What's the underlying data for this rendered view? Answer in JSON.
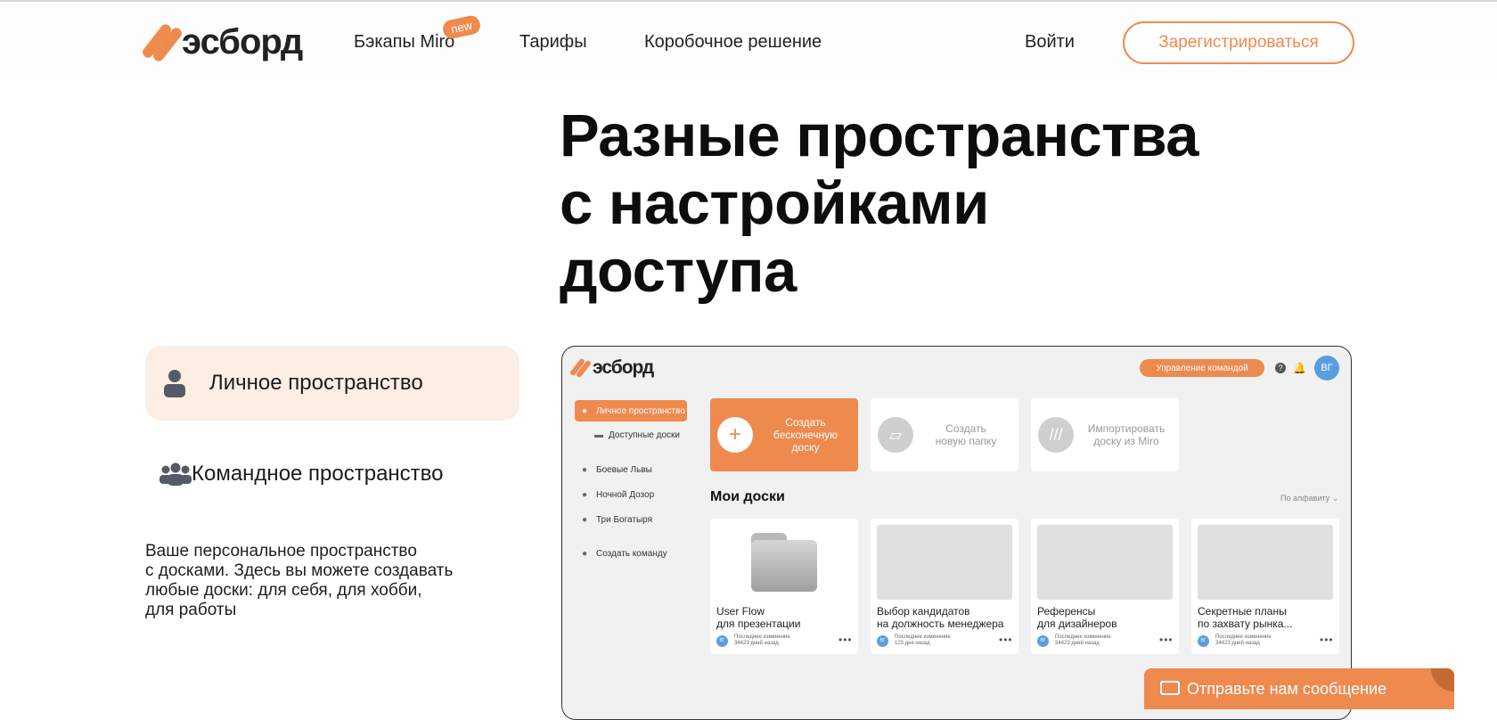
{
  "header": {
    "logo_text": "эсборд",
    "nav": [
      {
        "label": "Бэкапы Miro",
        "badge": "new"
      },
      {
        "label": "Тарифы"
      },
      {
        "label": "Коробочное решение"
      }
    ],
    "login": "Войти",
    "register": "Зарегистрироваться"
  },
  "hero": {
    "title_lines": [
      "Разные пространства",
      "с настройками",
      "доступа"
    ]
  },
  "tabs": {
    "personal": "Личное пространство",
    "team": "Командное пространство"
  },
  "description_lines": [
    "Ваше персональное пространство",
    "с досками. Здесь вы можете создавать",
    "любые доски: для себя, для хобби,",
    "для работы"
  ],
  "mock": {
    "logo_text": "эсборд",
    "manage_button": "Управление командой",
    "help_icon": "?",
    "avatar": "ВГ",
    "sidebar": [
      {
        "label": "Личное пространство",
        "icon": "person-icon",
        "active": true
      },
      {
        "label": "Доступные доски",
        "icon": "boards-icon"
      },
      {
        "label": "Боевые Львы",
        "icon": "team-icon"
      },
      {
        "label": "Ночной Дозор",
        "icon": "team-icon"
      },
      {
        "label": "Три Богатыря",
        "icon": "team-icon"
      },
      {
        "label": "Создать команду",
        "icon": "add-user-icon"
      }
    ],
    "actions": [
      {
        "label_lines": [
          "Создать",
          "бесконечную",
          "доску"
        ],
        "icon": "plus-icon"
      },
      {
        "label_lines": [
          "Создать",
          "новую папку"
        ],
        "icon": "folder-icon"
      },
      {
        "label_lines": [
          "Импортировать",
          "доску из Miro"
        ],
        "icon": "miro-icon"
      }
    ],
    "section_title": "Мои доски",
    "sort": "По алфавиту",
    "boards": [
      {
        "name_lines": [
          "User Flow",
          "для презентации"
        ],
        "meta_lines": [
          "Последнее изменение",
          "34423 дней назад"
        ],
        "avatar": "ВГ"
      },
      {
        "name_lines": [
          "Выбор кандидатов",
          "на должность менеджера"
        ],
        "meta_lines": [
          "Последнее изменение",
          "123 дня назад"
        ],
        "avatar": "ВГ"
      },
      {
        "name_lines": [
          "Референсы",
          "для дизайнеров"
        ],
        "meta_lines": [
          "Последнее изменение",
          "34423 дней назад"
        ],
        "avatar": "ВГ"
      },
      {
        "name_lines": [
          "Секретные планы",
          "по захвату рынка..."
        ],
        "meta_lines": [
          "Последнее изменение",
          "34423 дней назад"
        ],
        "avatar": "ВГ"
      }
    ]
  },
  "chat": {
    "label": "Отправьте нам сообщение"
  },
  "colors": {
    "accent": "#ef8a4f",
    "personal_tab_bg": "#fdeee4",
    "mock_bg": "#f1f1f1",
    "avatar_blue": "#5b9ee0"
  }
}
